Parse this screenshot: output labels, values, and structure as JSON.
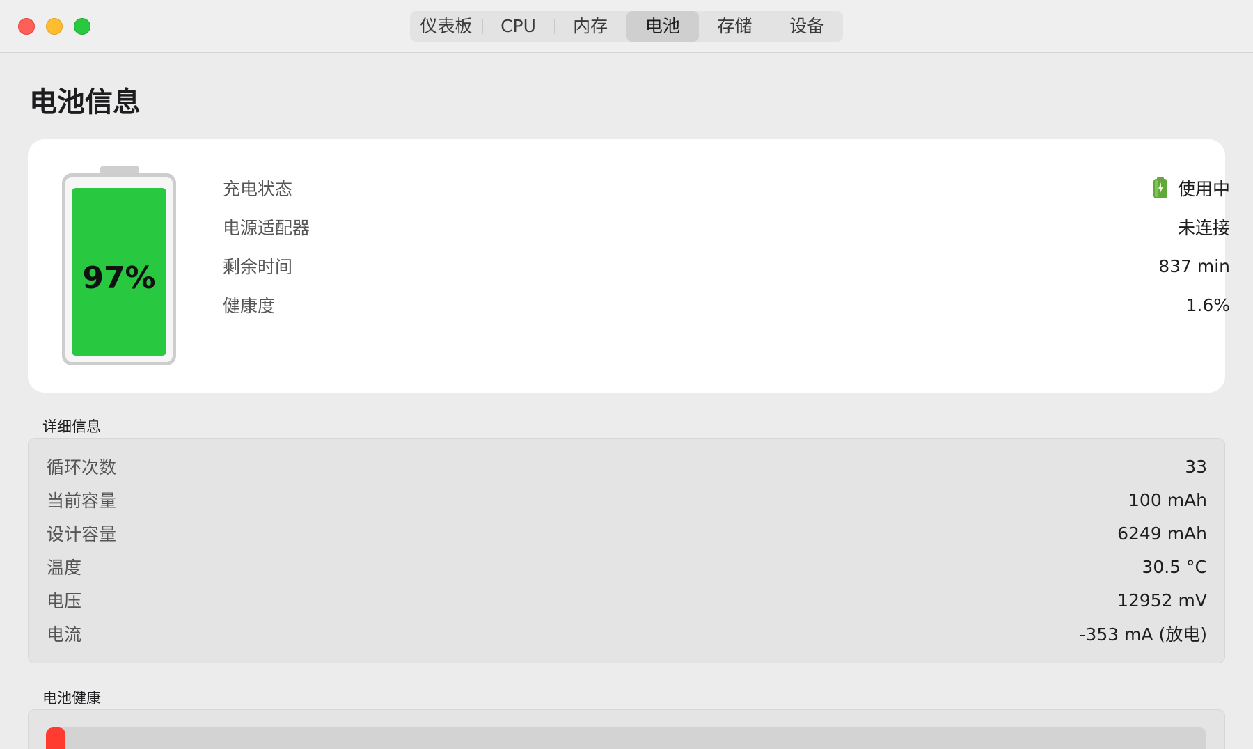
{
  "tabs": [
    {
      "label": "仪表板",
      "active": false
    },
    {
      "label": "CPU",
      "active": false
    },
    {
      "label": "内存",
      "active": false
    },
    {
      "label": "电池",
      "active": true
    },
    {
      "label": "存储",
      "active": false
    },
    {
      "label": "设备",
      "active": false
    }
  ],
  "page": {
    "title": "电池信息"
  },
  "summary": {
    "battery_percent_text": "97%",
    "battery_level": 0.97,
    "fill_color": "#28c840",
    "rows": [
      {
        "label": "充电状态",
        "value": "使用中",
        "icon": "battery-status-icon"
      },
      {
        "label": "电源适配器",
        "value": "未连接"
      },
      {
        "label": "剩余时间",
        "value": "837 min"
      },
      {
        "label": "健康度",
        "value": "1.6%"
      }
    ]
  },
  "details": {
    "section_title": "详细信息",
    "rows": [
      {
        "label": "循环次数",
        "value": "33"
      },
      {
        "label": "当前容量",
        "value": "100 mAh"
      },
      {
        "label": "设计容量",
        "value": "6249 mAh"
      },
      {
        "label": "温度",
        "value": "30.5 °C"
      },
      {
        "label": "电压",
        "value": "12952 mV"
      },
      {
        "label": "电流",
        "value": "-353 mA (放电)"
      }
    ]
  },
  "health": {
    "section_title": "电池健康",
    "level": 0.016,
    "bar_color": "#ff3b30"
  },
  "colors": {
    "close": "#fe5f57",
    "minimize": "#febc2e",
    "maximize": "#28c840"
  }
}
